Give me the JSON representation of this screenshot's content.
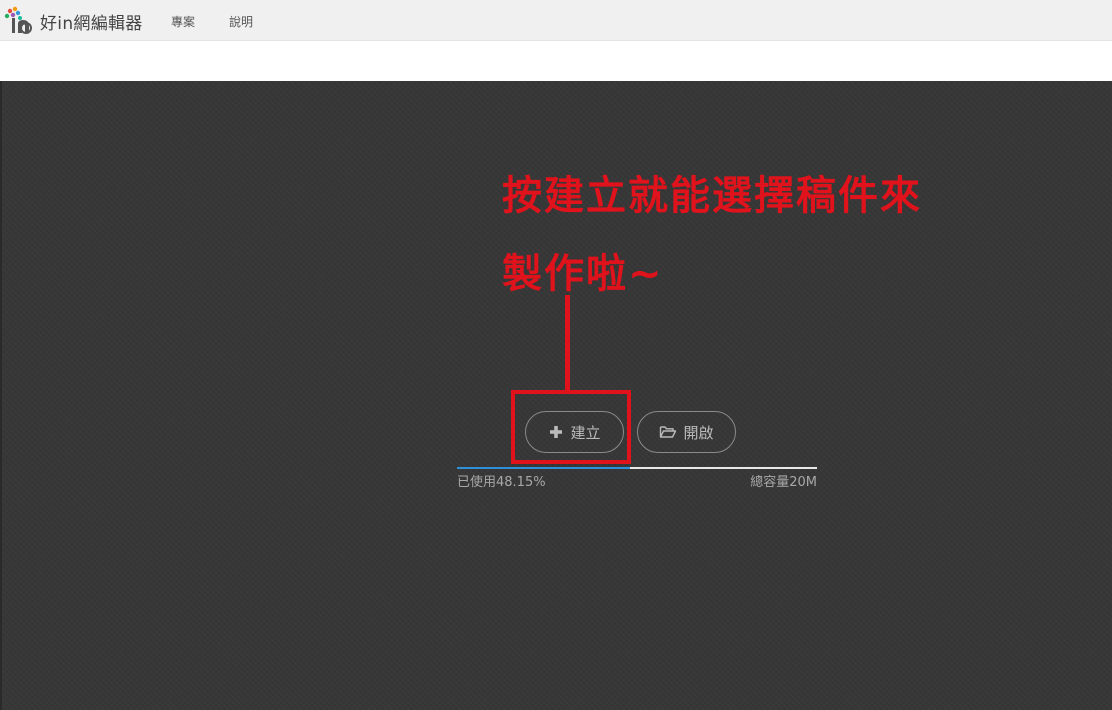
{
  "app": {
    "brand_name": "好in網編輯器",
    "logo_icon": "colorful-tree-logo-icon"
  },
  "nav": {
    "items": [
      {
        "label": "專案"
      },
      {
        "label": "說明"
      }
    ]
  },
  "annotation": {
    "line1": "按建立就能選擇稿件來",
    "line2": "製作啦~",
    "color": "#e0121b"
  },
  "actions": {
    "create": {
      "label": "建立",
      "icon": "plus-icon"
    },
    "open": {
      "label": "開啟",
      "icon": "folder-open-icon"
    }
  },
  "storage": {
    "used_label": "已使用48.15%",
    "used_fraction": 0.4815,
    "total_label": "總容量20M",
    "bar_color": "#2f8fd8"
  }
}
